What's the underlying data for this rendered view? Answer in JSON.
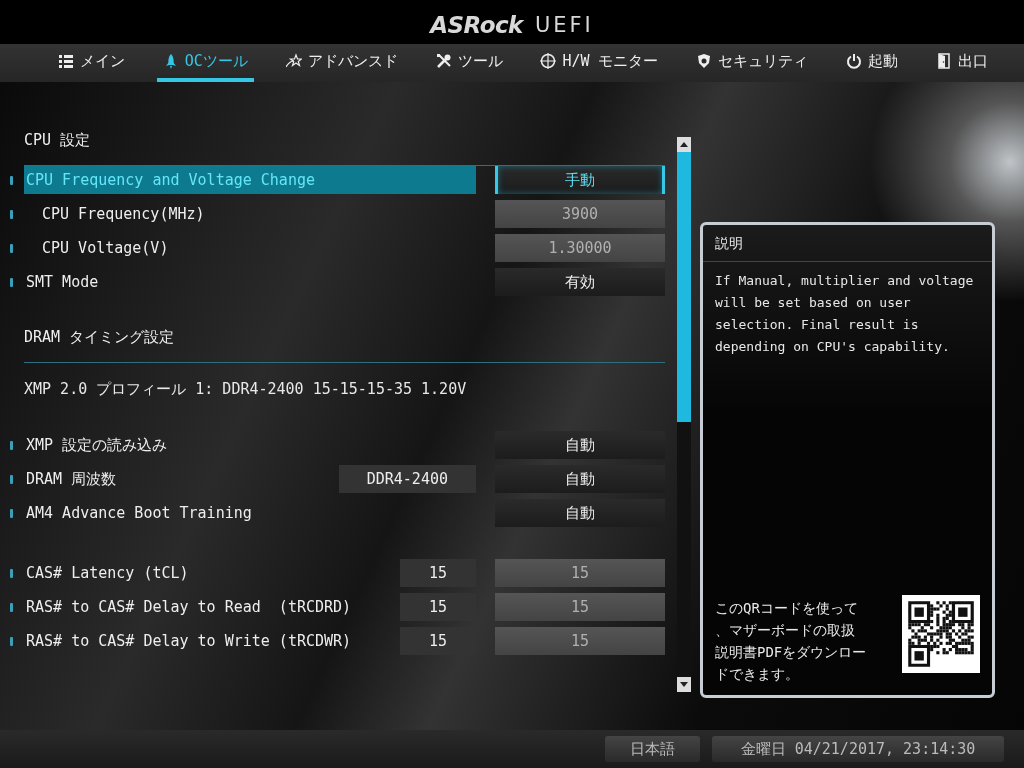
{
  "header": {
    "logo": "ASRock",
    "product": "UEFI"
  },
  "tabs": [
    {
      "label": "メイン",
      "selected": false
    },
    {
      "label": "OCツール",
      "selected": true
    },
    {
      "label": "アドバンスド",
      "selected": false
    },
    {
      "label": "ツール",
      "selected": false
    },
    {
      "label": "H/W モニター",
      "selected": false
    },
    {
      "label": "セキュリティ",
      "selected": false
    },
    {
      "label": "起動",
      "selected": false
    },
    {
      "label": "出口",
      "selected": false
    }
  ],
  "sections": [
    {
      "title": "CPU 設定",
      "groups": [
        [
          {
            "label": "CPU Frequency and Voltage Change",
            "selected": true,
            "value": "手動",
            "value_disabled": false,
            "children": [
              {
                "label": "CPU Frequency(MHz)",
                "selected": false,
                "value": "3900",
                "value_disabled": true
              },
              {
                "label": "CPU Voltage(V)",
                "selected": false,
                "value": "1.30000",
                "value_disabled": true
              }
            ]
          },
          {
            "label": "SMT Mode",
            "selected": false,
            "value": "有効",
            "value_disabled": false
          }
        ]
      ]
    },
    {
      "title": "DRAM タイミング設定",
      "note": "XMP 2.0 プロフィール 1: DDR4-2400 15-15-15-35 1.20V",
      "groups": [
        [
          {
            "label": "XMP 設定の読み込み",
            "selected": false,
            "value": "自動",
            "value_disabled": false
          },
          {
            "label": "DRAM 周波数",
            "selected": false,
            "current": "DDR4-2400",
            "value": "自動",
            "value_disabled": false
          },
          {
            "label": "AM4 Advance Boot Training",
            "selected": false,
            "value": "自動",
            "value_disabled": false
          }
        ],
        [
          {
            "label": "CAS# Latency (tCL)",
            "selected": false,
            "current": "15",
            "value": "15",
            "value_disabled": true
          },
          {
            "label": "RAS# to CAS# Delay to Read  (tRCDRD)",
            "selected": false,
            "current": "15",
            "value": "15",
            "value_disabled": true
          },
          {
            "label": "RAS# to CAS# Delay to Write (tRCDWR)",
            "selected": false,
            "current": "15",
            "value": "15",
            "value_disabled": true
          }
        ]
      ]
    }
  ],
  "help": {
    "title": "説明",
    "text": "If Manual, multiplier and voltage will be set based on user selection. Final result is depending on CPU's capability.",
    "qr_text": "このQRコードを使って、マザーボードの取扱説明書PDFをダウンロードできます。"
  },
  "status_bar": {
    "language": "日本語",
    "datetime": "金曜日 04/21/2017, 23:14:30"
  }
}
